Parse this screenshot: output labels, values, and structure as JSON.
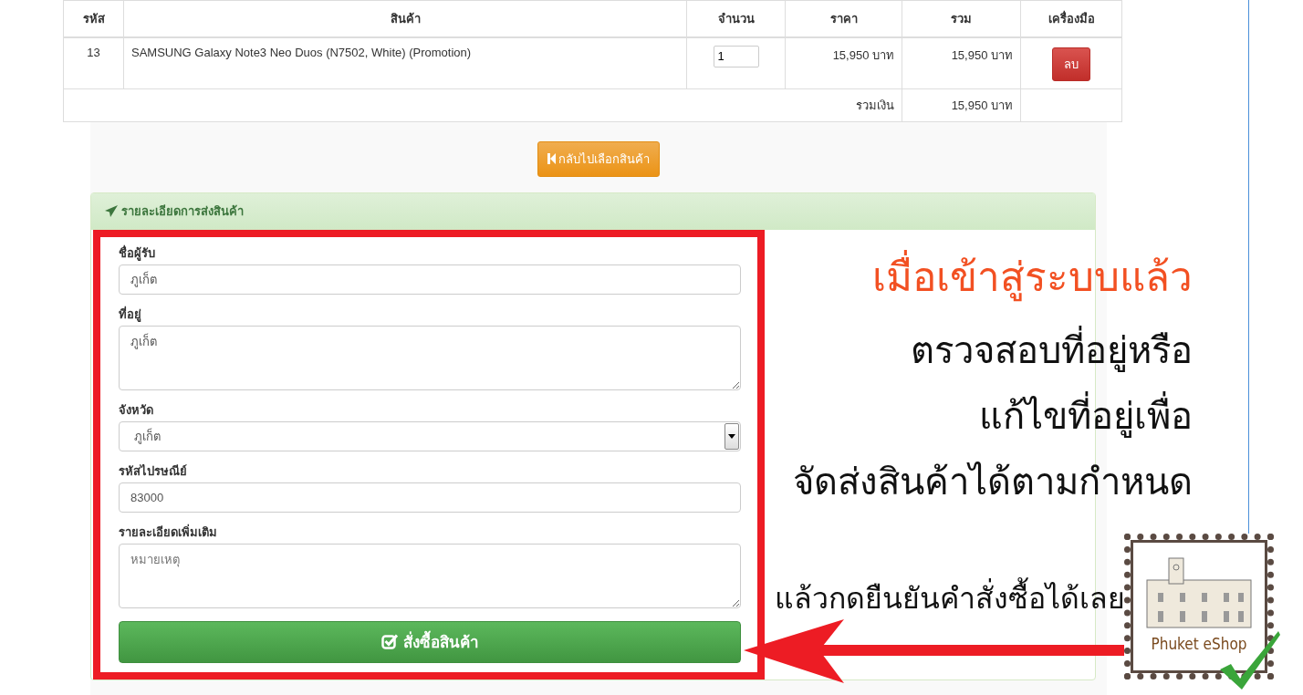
{
  "cart_table": {
    "columns": [
      "รหัส",
      "สินค้า",
      "จำนวน",
      "ราคา",
      "รวม",
      "เครื่องมือ"
    ],
    "rows": [
      {
        "code": "13",
        "product": "SAMSUNG Galaxy Note3 Neo Duos (N7502, White) (Promotion)",
        "quantity": "1",
        "price": "15,950 บาท",
        "total": "15,950 บาท",
        "action": "ลบ"
      }
    ],
    "summary": {
      "label": "รวมเงิน",
      "total": "15,950 บาท"
    }
  },
  "back_button": "กลับไปเลือกสินค้า",
  "shipping_panel": {
    "title": "รายละเอียดการส่งสินค้า",
    "fields": [
      {
        "kind": "input",
        "label": "ชื่อผู้รับ",
        "value": "ภูเก็ต"
      },
      {
        "kind": "textarea",
        "label": "ที่อยู่",
        "value": "ภูเก็ต"
      },
      {
        "kind": "select",
        "label": "จังหวัด",
        "value": "ภูเก็ต"
      },
      {
        "kind": "input",
        "label": "รหัสไปรษณีย์",
        "value": "83000"
      },
      {
        "kind": "textarea",
        "label": "รายละเอียดเพิ่มเติม",
        "placeholder": "หมายเหตุ"
      }
    ],
    "submit_button": "สั่งซื้อสินค้า"
  },
  "annotation": {
    "headline": "เมื่อเข้าสู่ระบบแล้ว",
    "lines": [
      "ตรวจสอบที่อยู่หรือ",
      "แก้ไขที่อยู่เพื่อ",
      "จัดส่งสินค้าได้ตามกำหนด"
    ],
    "footer": "แล้วกดยืนยันคำสั่งซื้อได้เลย"
  },
  "logo": {
    "text": "Phuket eShop"
  }
}
